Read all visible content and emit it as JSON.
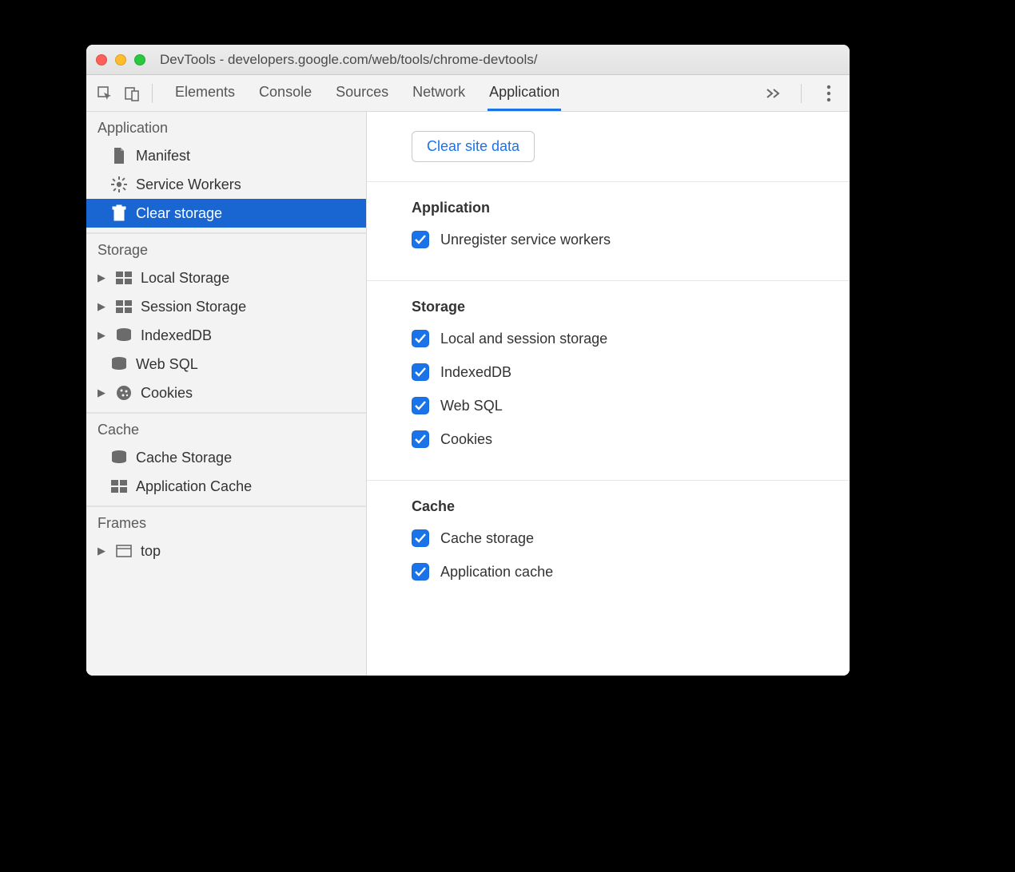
{
  "window": {
    "title": "DevTools - developers.google.com/web/tools/chrome-devtools/"
  },
  "tabs": {
    "items": [
      "Elements",
      "Console",
      "Sources",
      "Network",
      "Application"
    ],
    "active": 4
  },
  "sidebar": {
    "groups": [
      {
        "label": "Application",
        "items": [
          {
            "label": "Manifest",
            "icon": "file-icon",
            "caret": false,
            "selected": false
          },
          {
            "label": "Service Workers",
            "icon": "gear-icon",
            "caret": false,
            "selected": false
          },
          {
            "label": "Clear storage",
            "icon": "trash-icon",
            "caret": false,
            "selected": true
          }
        ]
      },
      {
        "label": "Storage",
        "items": [
          {
            "label": "Local Storage",
            "icon": "grid-icon",
            "caret": true
          },
          {
            "label": "Session Storage",
            "icon": "grid-icon",
            "caret": true
          },
          {
            "label": "IndexedDB",
            "icon": "database-icon",
            "caret": true
          },
          {
            "label": "Web SQL",
            "icon": "database-icon",
            "caret": false
          },
          {
            "label": "Cookies",
            "icon": "cookie-icon",
            "caret": true
          }
        ]
      },
      {
        "label": "Cache",
        "items": [
          {
            "label": "Cache Storage",
            "icon": "database-icon",
            "caret": false
          },
          {
            "label": "Application Cache",
            "icon": "grid-icon",
            "caret": false
          }
        ]
      },
      {
        "label": "Frames",
        "items": [
          {
            "label": "top",
            "icon": "frame-icon",
            "caret": true
          }
        ]
      }
    ]
  },
  "content": {
    "clear_button": "Clear site data",
    "sections": [
      {
        "title": "Application",
        "options": [
          {
            "label": "Unregister service workers",
            "checked": true
          }
        ]
      },
      {
        "title": "Storage",
        "options": [
          {
            "label": "Local and session storage",
            "checked": true
          },
          {
            "label": "IndexedDB",
            "checked": true
          },
          {
            "label": "Web SQL",
            "checked": true
          },
          {
            "label": "Cookies",
            "checked": true
          }
        ]
      },
      {
        "title": "Cache",
        "options": [
          {
            "label": "Cache storage",
            "checked": true
          },
          {
            "label": "Application cache",
            "checked": true
          }
        ]
      }
    ]
  },
  "colors": {
    "accent": "#1a73e8",
    "selection": "#1966d2"
  }
}
